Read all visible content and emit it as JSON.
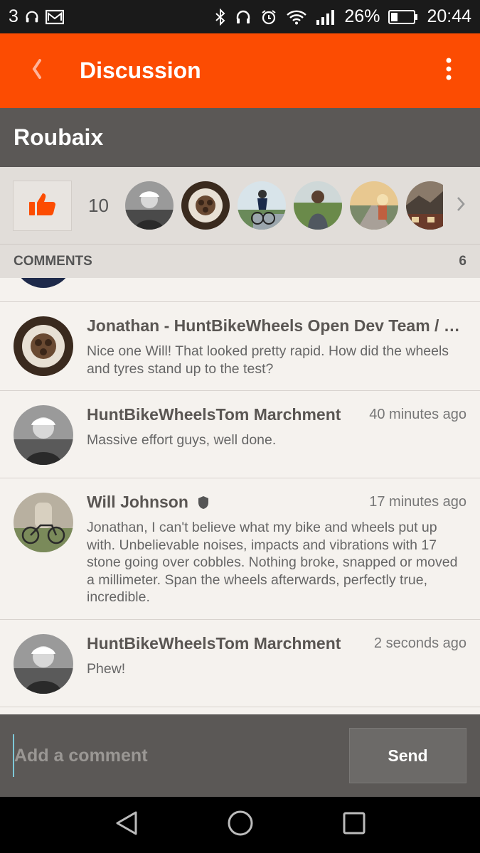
{
  "status_bar": {
    "notification_count": "3",
    "battery_percent": "26%",
    "time": "20:44",
    "icons": [
      "headphones-icon",
      "mail-icon",
      "bluetooth-icon",
      "headphones-icon",
      "alarm-icon",
      "wifi-icon",
      "signal-icon",
      "battery-icon"
    ]
  },
  "app_bar": {
    "title": "Discussion",
    "background": "#fc4c02"
  },
  "activity": {
    "title": "Roubaix"
  },
  "kudos": {
    "count": "10",
    "avatars": [
      "cyclist-bw",
      "wheel-texture",
      "cyclist-road",
      "person-field",
      "road-sunset",
      "mountain-town"
    ]
  },
  "comments_section": {
    "label": "COMMENTS",
    "count": "6"
  },
  "comments": [
    {
      "author": "Jonathan - HuntBikeWheels Open Dev Team / S...",
      "time": "",
      "text": "Nice one Will! That looked pretty rapid. How did the wheels and tyres stand up to the test?"
    },
    {
      "author": "HuntBikeWheelsTom Marchment",
      "time": "40 minutes ago",
      "text": "Massive effort guys, well done."
    },
    {
      "author": "Will Johnson",
      "time": "17 minutes ago",
      "text": "Jonathan, I can't believe what my bike and wheels put up with. Unbelievable noises, impacts and vibrations with 17 stone going over cobbles. Nothing broke, snapped or moved a millimeter.  Span the wheels afterwards, perfectly true, incredible."
    },
    {
      "author": "HuntBikeWheelsTom Marchment",
      "time": "2 seconds ago",
      "text": "Phew!"
    }
  ],
  "composer": {
    "placeholder": "Add a comment",
    "send_label": "Send"
  }
}
